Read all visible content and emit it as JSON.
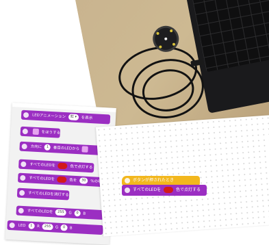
{
  "left_panel": {
    "blocks": [
      {
        "label": "LEDアニメーション",
        "value": "虹 ▾",
        "suffix": "を表示"
      },
      {
        "label": "をほうする"
      },
      {
        "label": "方向に",
        "value": "1",
        "suffix": "番目のLEDから"
      },
      {
        "label": "すべてのLEDを",
        "suffix": "色で点灯する"
      },
      {
        "label": "すべてのLEDを",
        "middle": "色を",
        "value": "30",
        "suffix": "%の明"
      },
      {
        "label": "すべてのLEDを消灯する"
      },
      {
        "label": "すべてのLEDを",
        "r": "255",
        "g_label": "G",
        "g": "0",
        "b_label": "B"
      },
      {
        "label": "LED",
        "index": "1",
        "r_label": "R",
        "r": "255",
        "g_label": "G",
        "g": "0",
        "b_label": "B"
      }
    ]
  },
  "canvas": {
    "hat_label": "ボタンが押されたとき",
    "cmd_prefix": "すべてのLEDを",
    "cmd_suffix": "色で点灯する"
  },
  "colors": {
    "block_purple": "#9b2ec2",
    "hat_yellow": "#f2b71e",
    "led_red": "#d21a1a"
  }
}
